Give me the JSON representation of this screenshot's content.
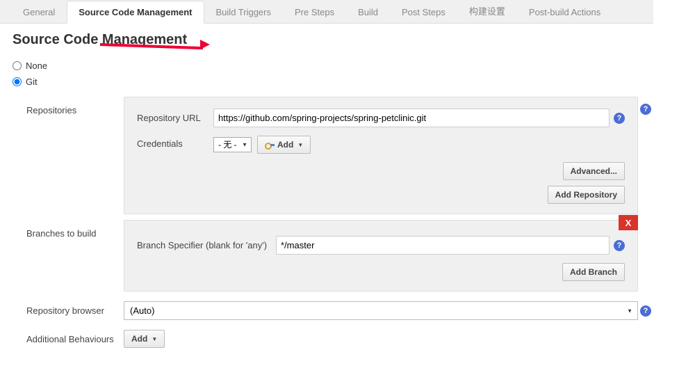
{
  "tabs": {
    "general": "General",
    "scm": "Source Code Management",
    "triggers": "Build Triggers",
    "pre": "Pre Steps",
    "build": "Build",
    "post": "Post Steps",
    "settings_cn": "构建设置",
    "postbuild": "Post-build Actions"
  },
  "section_title": "Source Code Management",
  "radio": {
    "none": "None",
    "git": "Git"
  },
  "repos": {
    "label": "Repositories",
    "url_label": "Repository URL",
    "url_value": "https://github.com/spring-projects/spring-petclinic.git",
    "cred_label": "Credentials",
    "cred_none": "- 无 -",
    "add_btn": "Add",
    "advanced_btn": "Advanced...",
    "add_repo_btn": "Add Repository"
  },
  "branches": {
    "label": "Branches to build",
    "spec_label": "Branch Specifier (blank for 'any')",
    "spec_value": "*/master",
    "add_branch_btn": "Add Branch",
    "delete": "X"
  },
  "browser": {
    "label": "Repository browser",
    "auto": "(Auto)"
  },
  "behaviours": {
    "label": "Additional Behaviours",
    "add": "Add"
  },
  "help": "?"
}
